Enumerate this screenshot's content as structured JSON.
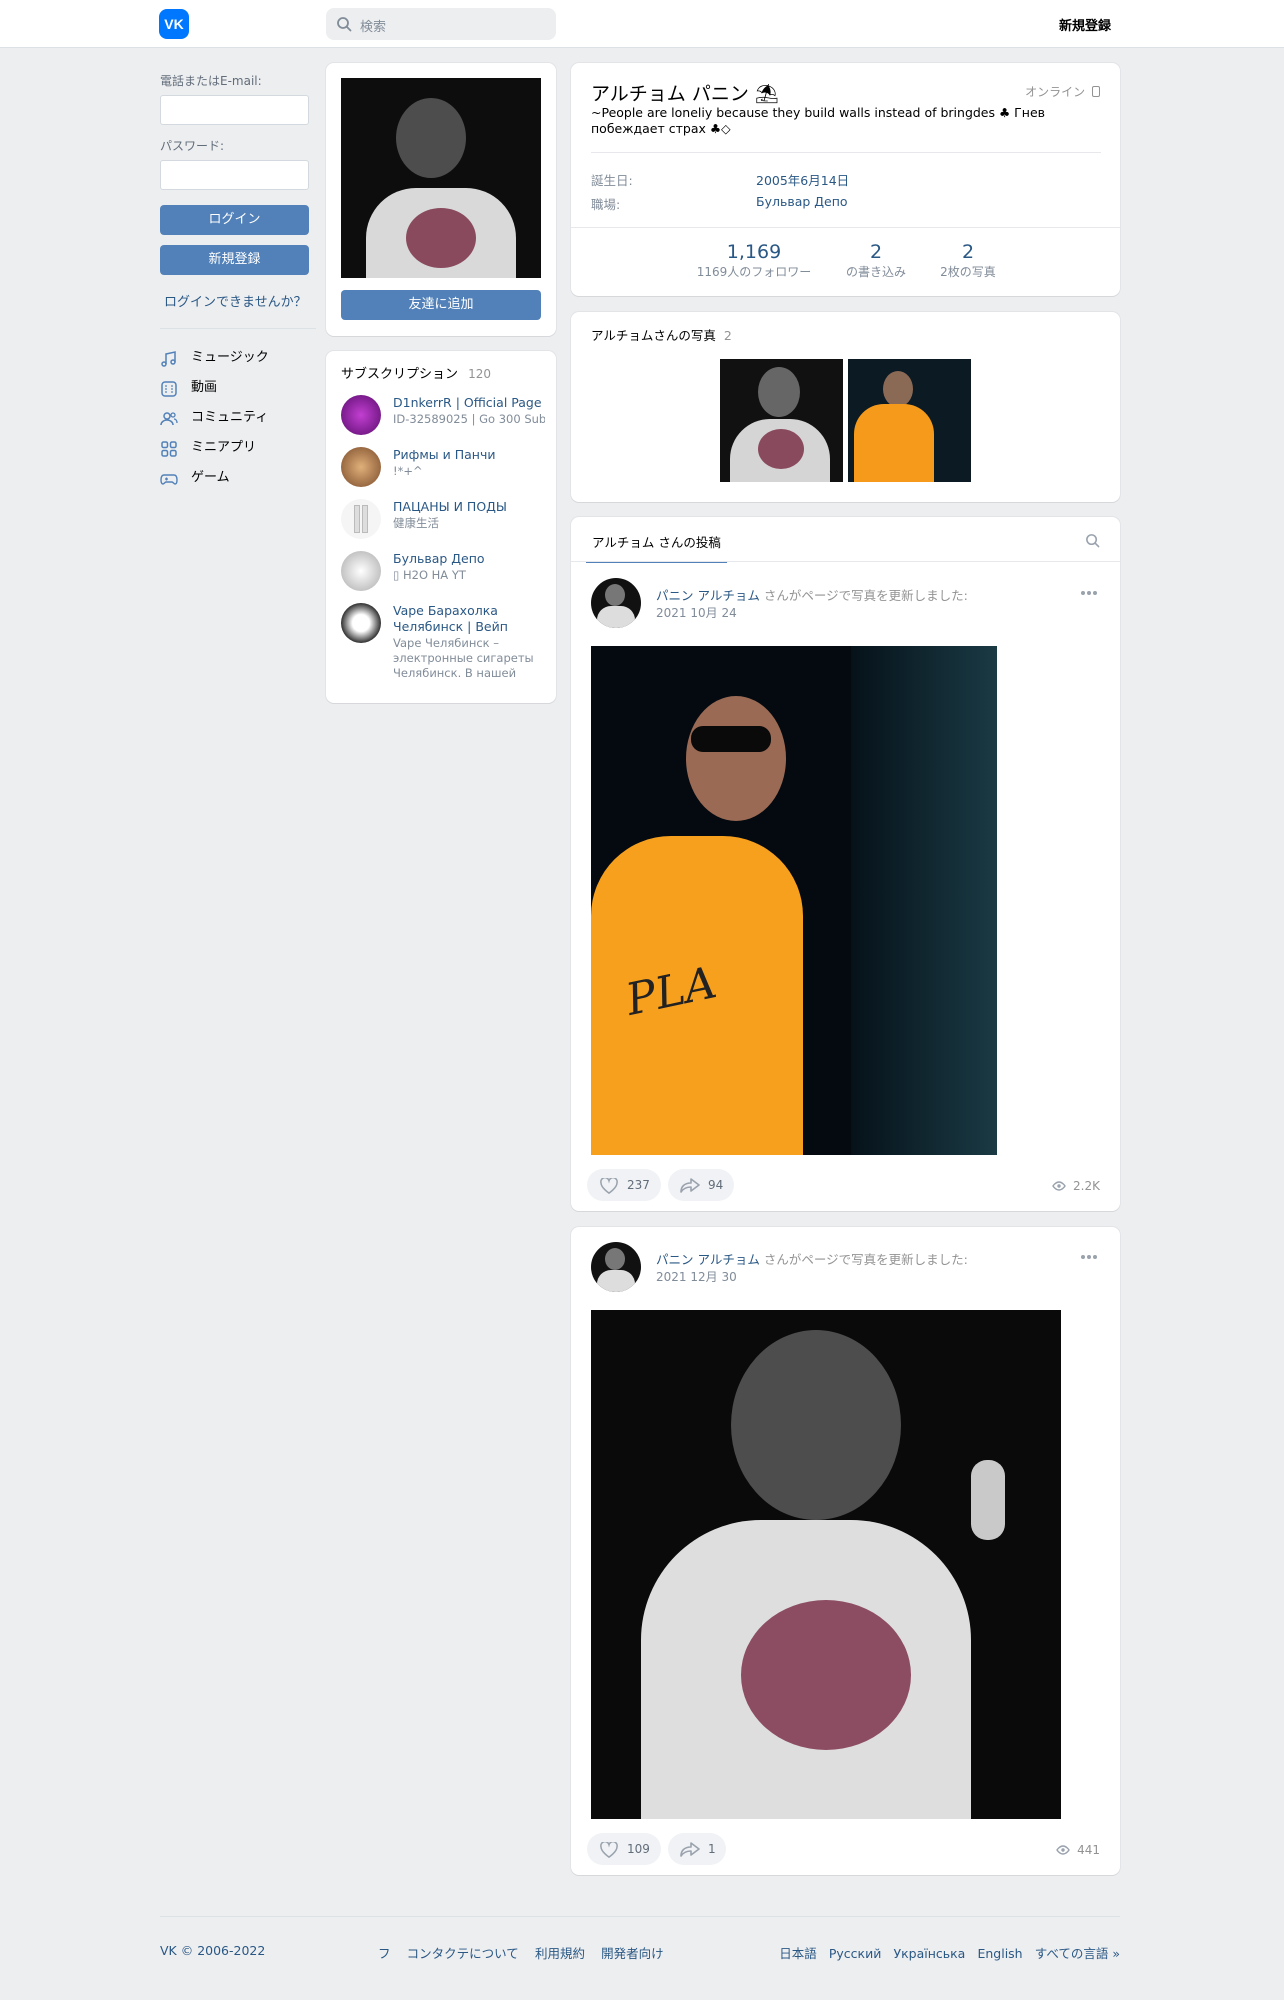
{
  "header": {
    "logo_text": "VK",
    "search_placeholder": "検索",
    "signup_label": "新規登録"
  },
  "login": {
    "phone_label": "電話またはE-mail:",
    "password_label": "パスワード:",
    "login_button": "ログイン",
    "signup_button": "新規登録",
    "forgot_link": "ログインできませんか？"
  },
  "nav": [
    {
      "label": "ミュージック",
      "icon": "music-icon"
    },
    {
      "label": "動画",
      "icon": "video-icon"
    },
    {
      "label": "コミュニティ",
      "icon": "community-icon"
    },
    {
      "label": "ミニアプリ",
      "icon": "apps-icon"
    },
    {
      "label": "ゲーム",
      "icon": "gamepad-icon"
    }
  ],
  "profile": {
    "add_friend": "友達に追加",
    "name": "アルチョム パニン",
    "name_emoji": "⛱",
    "status": "~People are loneliy because they build walls instead of bringdes ♣ Гнев побеждает страх ♣◇",
    "online": "オンライン",
    "birthday_label": "誕生日:",
    "birthday_value": "2005年6月14日",
    "work_label": "職場:",
    "work_value": "Бульвар Депо",
    "stats": [
      {
        "value": "1,169",
        "label": "1169人のフォロワー"
      },
      {
        "value": "2",
        "label": "の書き込み"
      },
      {
        "value": "2",
        "label": "2枚の写真"
      }
    ]
  },
  "subscriptions": {
    "title": "サブスクリプション",
    "count": "120",
    "items": [
      {
        "name": "D1nkerrR | Official Page",
        "desc": [
          "ID-32589025 | Go 300 Sub…"
        ],
        "color": "#8a1a9e"
      },
      {
        "name": "Рифмы и Панчи",
        "desc": [
          "!*+^"
        ],
        "color": "#b07a4a"
      },
      {
        "name": "ПАЦАНЫ И ПОДЫ",
        "desc": [
          "健康生活"
        ],
        "color": "#e8e8e8"
      },
      {
        "name": "Бульвар Депо",
        "desc": [
          "▯ H2O НА YT"
        ],
        "color": "#cfcfcf"
      },
      {
        "name": "Vape Барахолка Челябинск | Вейп",
        "desc": [
          "Vape Челябинск –",
          "электронные сигареты",
          "Челябинск. В нашей"
        ],
        "color": "#444444"
      }
    ]
  },
  "photos": {
    "title": "アルチョムさんの写真",
    "count": "2"
  },
  "wall": {
    "tab": "アルチョム さんの投稿",
    "posts": [
      {
        "author": "パニン アルチョム",
        "action": "さんがページで写真を更新しました:",
        "date": "2021 10月 24",
        "likes": "237",
        "shares": "94",
        "views": "2.2K"
      },
      {
        "author": "パニン アルチョム",
        "action": "さんがページで写真を更新しました:",
        "date": "2021 12月 30",
        "likes": "109",
        "shares": "1",
        "views": "441"
      }
    ]
  },
  "footer": {
    "copyright": "VK © 2006-2022",
    "links": [
      "フ",
      "コンタクテについて",
      "利用規約",
      "開発者向け"
    ],
    "languages": [
      "日本語",
      "Русский",
      "Українська",
      "English",
      "すべての言語 »"
    ]
  },
  "colors": {
    "accent": "#5181b8",
    "link": "#2a5885",
    "background": "#edeef0",
    "brand": "#0077ff"
  }
}
